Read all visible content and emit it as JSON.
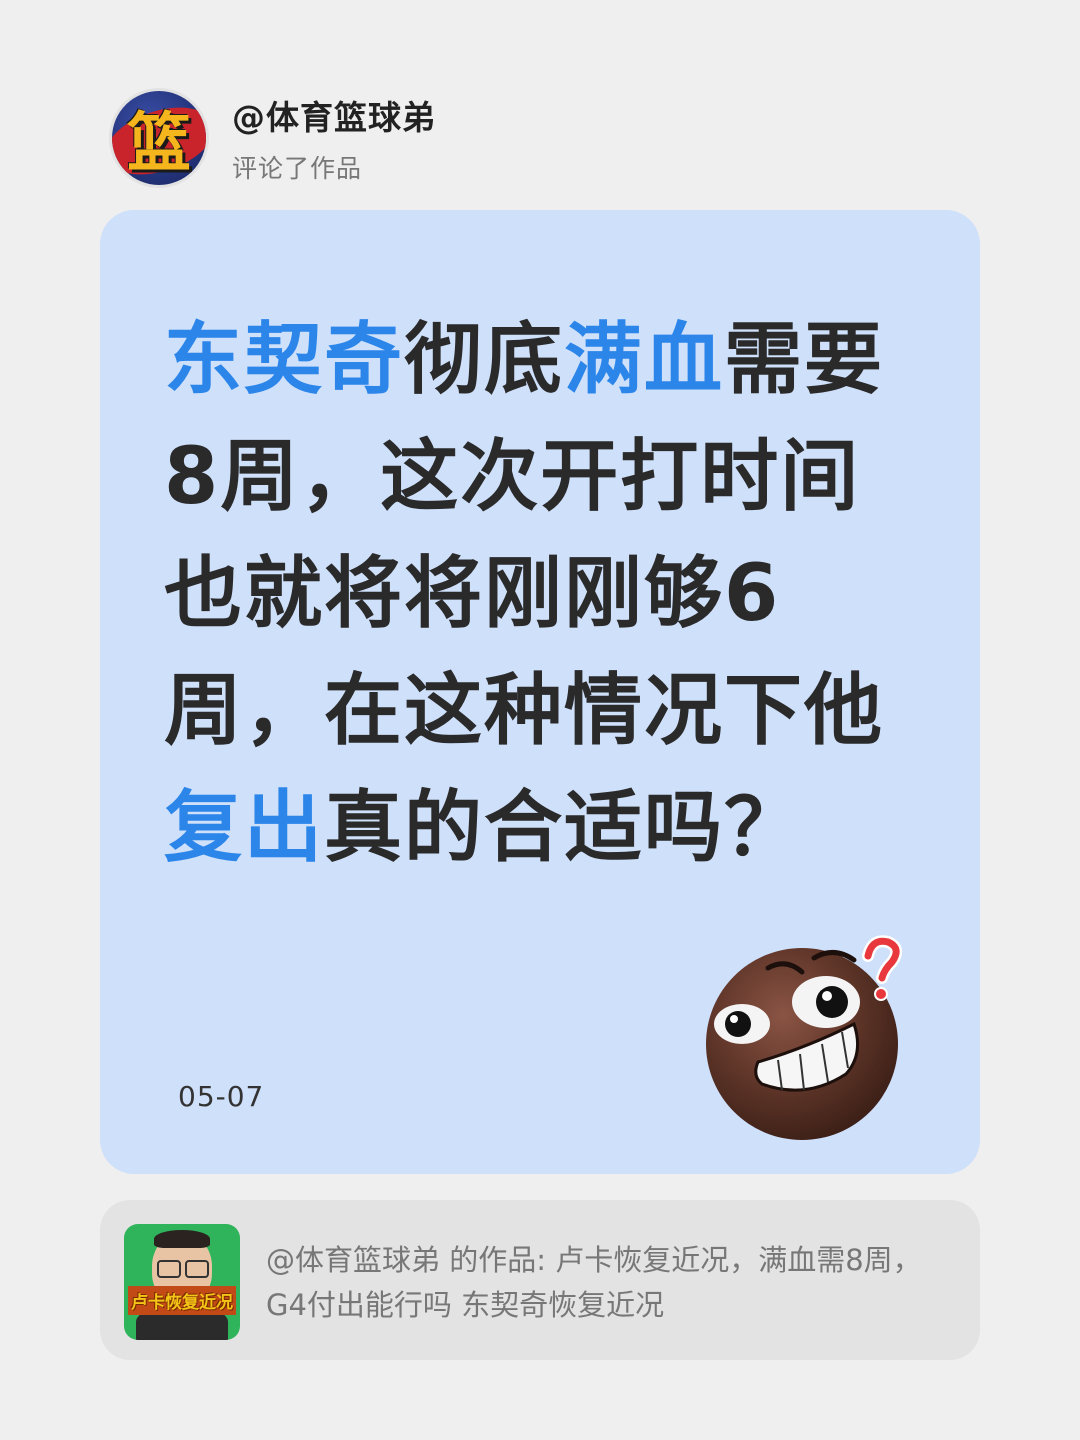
{
  "header": {
    "username": "@体育篮球弟",
    "action": "评论了作品",
    "avatar_glyph": "篮"
  },
  "comment": {
    "segments": [
      {
        "text": "东契奇",
        "highlight": true
      },
      {
        "text": "彻底",
        "highlight": false
      },
      {
        "text": "满血",
        "highlight": true
      },
      {
        "text": "需要8周，这次开打时间也就将将刚刚够6周，在这种情况下他",
        "highlight": false
      },
      {
        "text": "复出",
        "highlight": true
      },
      {
        "text": "真的合适吗？",
        "highlight": false
      }
    ],
    "date": "05-07",
    "emoji": "thinking-grin-emoji"
  },
  "reference": {
    "thumbnail_caption": "卢卡恢复近况",
    "text": "@体育篮球弟 的作品: 卢卡恢复近况，满血需8周，G4付出能行吗 东契奇恢复近况"
  },
  "colors": {
    "accent": "#2c86ea",
    "card_bg": "#cfe0fb",
    "page_bg": "#efefef"
  }
}
